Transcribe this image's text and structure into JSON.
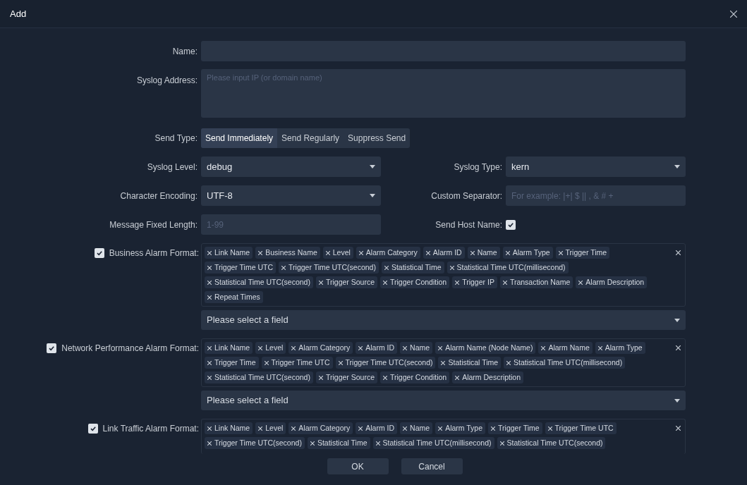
{
  "dialog": {
    "title": "Add"
  },
  "name_field": {
    "label": "Name:"
  },
  "syslog_address": {
    "label": "Syslog Address:",
    "placeholder": "Please input IP (or domain name)"
  },
  "send_type": {
    "label": "Send Type:",
    "options": [
      {
        "label": "Send Immediately",
        "selected": true
      },
      {
        "label": "Send Regularly",
        "selected": false
      },
      {
        "label": "Suppress Send",
        "selected": false
      }
    ]
  },
  "rows": [
    {
      "left": {
        "kind": "select",
        "label": "Syslog Level:",
        "value": "debug"
      },
      "right": {
        "kind": "select",
        "label": "Syslog Type:",
        "value": "kern"
      }
    },
    {
      "left": {
        "kind": "select",
        "label": "Character Encoding:",
        "value": "UTF-8"
      },
      "right": {
        "kind": "input",
        "label": "Custom Separator:",
        "placeholder": "For example: |+| $ || , & # +"
      }
    },
    {
      "left": {
        "kind": "input",
        "label": "Message Fixed Length:",
        "placeholder": "1-99"
      },
      "right": {
        "kind": "checkbox",
        "label": "Send Host Name:",
        "checked": true
      }
    }
  ],
  "formats": [
    {
      "label": "Business Alarm Format:",
      "checked": true,
      "tags": [
        "Link Name",
        "Business Name",
        "Level",
        "Alarm Category",
        "Alarm ID",
        "Name",
        "Alarm Type",
        "Trigger Time",
        "Trigger Time UTC",
        "Trigger Time UTC(second)",
        "Statistical Time",
        "Statistical Time UTC(millisecond)",
        "Statistical Time UTC(second)",
        "Trigger Source",
        "Trigger Condition",
        "Trigger IP",
        "Transaction Name",
        "Alarm Description",
        "Repeat Times"
      ],
      "select": {
        "placeholder": "Please select a field"
      }
    },
    {
      "label": "Network Performance Alarm Format:",
      "checked": true,
      "tags": [
        "Link Name",
        "Level",
        "Alarm Category",
        "Alarm ID",
        "Name",
        "Alarm Name (Node Name)",
        "Alarm Name",
        "Alarm Type",
        "Trigger Time",
        "Trigger Time UTC",
        "Trigger Time UTC(second)",
        "Statistical Time",
        "Statistical Time UTC(millisecond)",
        "Statistical Time UTC(second)",
        "Trigger Source",
        "Trigger Condition",
        "Alarm Description"
      ],
      "select": {
        "placeholder": "Please select a field"
      }
    },
    {
      "label": "Link Traffic Alarm Format:",
      "checked": true,
      "tags": [
        "Link Name",
        "Level",
        "Alarm Category",
        "Alarm ID",
        "Name",
        "Alarm Type",
        "Trigger Time",
        "Trigger Time UTC",
        "Trigger Time UTC(second)",
        "Statistical Time",
        "Statistical Time UTC(millisecond)",
        "Statistical Time UTC(second)"
      ]
    }
  ],
  "buttons": [
    "OK",
    "Cancel"
  ]
}
